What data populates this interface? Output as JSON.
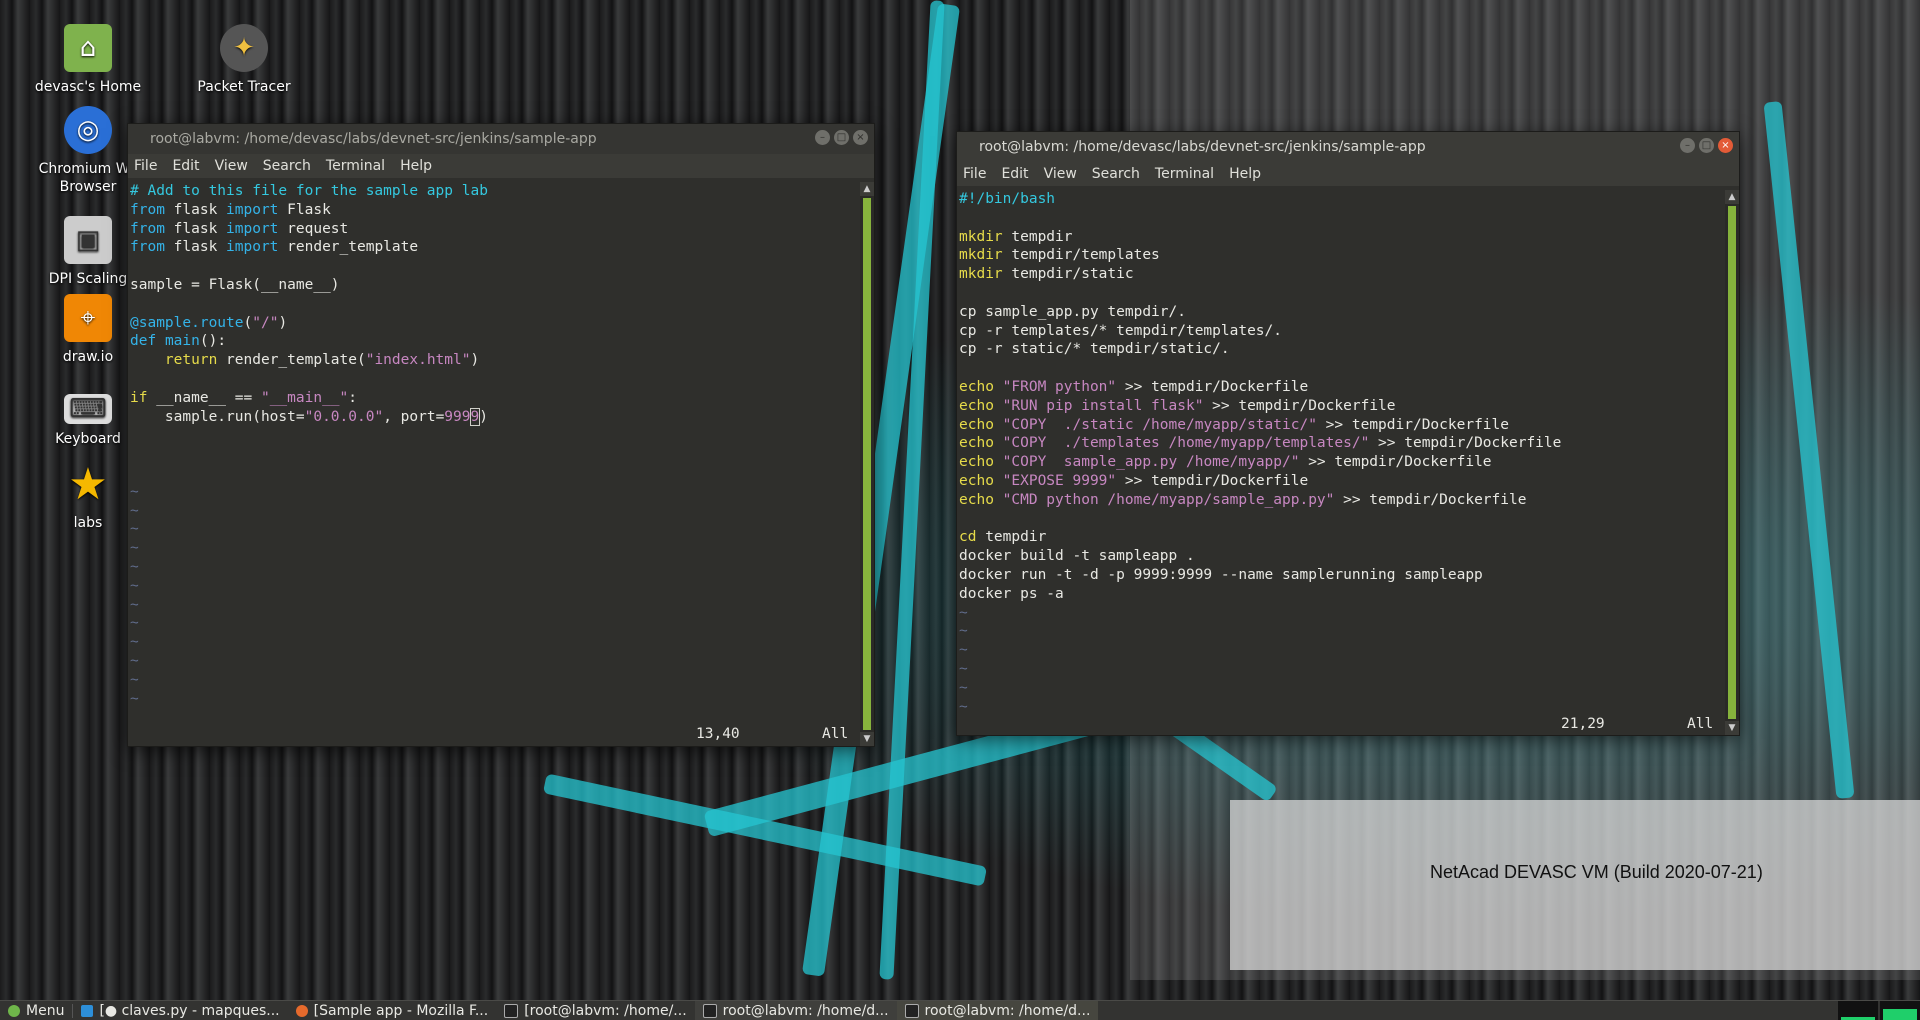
{
  "desktop": {
    "icons": [
      {
        "label": "devasc's Home",
        "icon": "home-folder-icon"
      },
      {
        "label": "Packet Tracer",
        "icon": "packet-tracer-icon"
      },
      {
        "label": "Chromium Web Browser",
        "icon": "chromium-icon"
      },
      {
        "label": "DPI Scaling",
        "icon": "dpi-scaling-icon"
      },
      {
        "label": "draw.io",
        "icon": "drawio-icon"
      },
      {
        "label": "Keyboard",
        "icon": "keyboard-icon"
      },
      {
        "label": "labs",
        "icon": "star-icon"
      }
    ],
    "icon_chromium_line1": "Chromium We",
    "icon_chromium_line2": "Browser",
    "icon_dpi_label": "DPI Scaling",
    "watermark": "NetAcad DEVASC VM (Build 2020-07-21)"
  },
  "left_window": {
    "title": "root@labvm: /home/devasc/labs/devnet-src/jenkins/sample-app",
    "menu": [
      "File",
      "Edit",
      "View",
      "Search",
      "Terminal",
      "Help"
    ],
    "lines": [
      [
        {
          "t": "# Add to this file for the sample app lab",
          "c": "cmt"
        }
      ],
      [
        {
          "t": "from",
          "c": "kw2"
        },
        {
          "t": " flask ",
          "c": ""
        },
        {
          "t": "import",
          "c": "kw2"
        },
        {
          "t": " Flask",
          "c": ""
        }
      ],
      [
        {
          "t": "from",
          "c": "kw2"
        },
        {
          "t": " flask ",
          "c": ""
        },
        {
          "t": "import",
          "c": "kw2"
        },
        {
          "t": " request",
          "c": ""
        }
      ],
      [
        {
          "t": "from",
          "c": "kw2"
        },
        {
          "t": " flask ",
          "c": ""
        },
        {
          "t": "import",
          "c": "kw2"
        },
        {
          "t": " render_template",
          "c": ""
        }
      ],
      [
        {
          "t": "",
          "c": ""
        }
      ],
      [
        {
          "t": "sample = Flask(__name__)",
          "c": ""
        }
      ],
      [
        {
          "t": "",
          "c": ""
        }
      ],
      [
        {
          "t": "@sample.route",
          "c": "kw2"
        },
        {
          "t": "(",
          "c": ""
        },
        {
          "t": "\"/\"",
          "c": "str"
        },
        {
          "t": ")",
          "c": ""
        }
      ],
      [
        {
          "t": "def",
          "c": "kw2"
        },
        {
          "t": " ",
          "c": ""
        },
        {
          "t": "main",
          "c": "kw2"
        },
        {
          "t": "():",
          "c": ""
        }
      ],
      [
        {
          "t": "    ",
          "c": ""
        },
        {
          "t": "return",
          "c": "kw"
        },
        {
          "t": " render_template(",
          "c": ""
        },
        {
          "t": "\"index.html\"",
          "c": "str"
        },
        {
          "t": ")",
          "c": ""
        }
      ],
      [
        {
          "t": "",
          "c": ""
        }
      ],
      [
        {
          "t": "if",
          "c": "kw"
        },
        {
          "t": " __name__ == ",
          "c": ""
        },
        {
          "t": "\"__main__\"",
          "c": "str"
        },
        {
          "t": ":",
          "c": ""
        }
      ],
      [
        {
          "t": "    sample.run(host=",
          "c": ""
        },
        {
          "t": "\"0.0.0.0\"",
          "c": "str"
        },
        {
          "t": ", port=",
          "c": ""
        },
        {
          "t": "999",
          "c": "str"
        },
        {
          "t": "9",
          "c": "str cursor"
        },
        {
          "t": ")",
          "c": ""
        }
      ],
      [
        {
          "t": "",
          "c": ""
        }
      ],
      [
        {
          "t": "",
          "c": ""
        }
      ],
      [
        {
          "t": "",
          "c": ""
        }
      ],
      [
        {
          "t": "~",
          "c": "tilde"
        }
      ],
      [
        {
          "t": "~",
          "c": "tilde"
        }
      ],
      [
        {
          "t": "~",
          "c": "tilde"
        }
      ],
      [
        {
          "t": "~",
          "c": "tilde"
        }
      ],
      [
        {
          "t": "~",
          "c": "tilde"
        }
      ],
      [
        {
          "t": "~",
          "c": "tilde"
        }
      ],
      [
        {
          "t": "~",
          "c": "tilde"
        }
      ],
      [
        {
          "t": "~",
          "c": "tilde"
        }
      ],
      [
        {
          "t": "~",
          "c": "tilde"
        }
      ],
      [
        {
          "t": "~",
          "c": "tilde"
        }
      ],
      [
        {
          "t": "~",
          "c": "tilde"
        }
      ],
      [
        {
          "t": "~",
          "c": "tilde"
        }
      ]
    ],
    "status_pos": "13,40",
    "status_all": "All"
  },
  "right_window": {
    "title": "root@labvm: /home/devasc/labs/devnet-src/jenkins/sample-app",
    "menu": [
      "File",
      "Edit",
      "View",
      "Search",
      "Terminal",
      "Help"
    ],
    "lines": [
      [
        {
          "t": "#!/bin/bash",
          "c": "cmt"
        }
      ],
      [
        {
          "t": "",
          "c": ""
        }
      ],
      [
        {
          "t": "mkdir",
          "c": "kw"
        },
        {
          "t": " tempdir",
          "c": ""
        }
      ],
      [
        {
          "t": "mkdir",
          "c": "kw"
        },
        {
          "t": " tempdir/templates",
          "c": ""
        }
      ],
      [
        {
          "t": "mkdir",
          "c": "kw"
        },
        {
          "t": " tempdir/static",
          "c": ""
        }
      ],
      [
        {
          "t": "",
          "c": ""
        }
      ],
      [
        {
          "t": "cp sample_app.py tempdir/.",
          "c": ""
        }
      ],
      [
        {
          "t": "cp -r templates/* tempdir/templates/.",
          "c": ""
        }
      ],
      [
        {
          "t": "cp -r static/* tempdir/static/.",
          "c": ""
        }
      ],
      [
        {
          "t": "",
          "c": ""
        }
      ],
      [
        {
          "t": "echo",
          "c": "kw"
        },
        {
          "t": " ",
          "c": ""
        },
        {
          "t": "\"FROM python\"",
          "c": "str"
        },
        {
          "t": " >> tempdir/Dockerfile",
          "c": ""
        }
      ],
      [
        {
          "t": "echo",
          "c": "kw"
        },
        {
          "t": " ",
          "c": ""
        },
        {
          "t": "\"RUN pip install flask\"",
          "c": "str"
        },
        {
          "t": " >> tempdir/Dockerfile",
          "c": ""
        }
      ],
      [
        {
          "t": "echo",
          "c": "kw"
        },
        {
          "t": " ",
          "c": ""
        },
        {
          "t": "\"COPY  ./static /home/myapp/static/\"",
          "c": "str"
        },
        {
          "t": " >> tempdir/Dockerfile",
          "c": ""
        }
      ],
      [
        {
          "t": "echo",
          "c": "kw"
        },
        {
          "t": " ",
          "c": ""
        },
        {
          "t": "\"COPY  ./templates /home/myapp/templates/\"",
          "c": "str"
        },
        {
          "t": " >> tempdir/Dockerfile",
          "c": ""
        }
      ],
      [
        {
          "t": "echo",
          "c": "kw"
        },
        {
          "t": " ",
          "c": ""
        },
        {
          "t": "\"COPY  sample_app.py /home/myapp/\"",
          "c": "str"
        },
        {
          "t": " >> tempdir/Dockerfile",
          "c": ""
        }
      ],
      [
        {
          "t": "echo",
          "c": "kw"
        },
        {
          "t": " ",
          "c": ""
        },
        {
          "t": "\"EXPOSE 9999\"",
          "c": "str"
        },
        {
          "t": " >> tempdir/Dockerfile",
          "c": ""
        }
      ],
      [
        {
          "t": "echo",
          "c": "kw"
        },
        {
          "t": " ",
          "c": ""
        },
        {
          "t": "\"CMD python /home/myapp/sample_app.py\"",
          "c": "str"
        },
        {
          "t": " >> tempdir/Dockerfile",
          "c": ""
        }
      ],
      [
        {
          "t": "",
          "c": ""
        }
      ],
      [
        {
          "t": "cd",
          "c": "kw"
        },
        {
          "t": " tempdir",
          "c": ""
        }
      ],
      [
        {
          "t": "docker build -t sampleapp .",
          "c": ""
        }
      ],
      [
        {
          "t": "docker run -t -d -p 9999:9999 --name samplerunning sampleapp",
          "c": ""
        }
      ],
      [
        {
          "t": "docker ps -a",
          "c": ""
        }
      ],
      [
        {
          "t": "~",
          "c": "tilde"
        }
      ],
      [
        {
          "t": "~",
          "c": "tilde"
        }
      ],
      [
        {
          "t": "~",
          "c": "tilde"
        }
      ],
      [
        {
          "t": "~",
          "c": "tilde"
        }
      ],
      [
        {
          "t": "~",
          "c": "tilde"
        }
      ],
      [
        {
          "t": "~",
          "c": "tilde"
        }
      ]
    ],
    "status_pos": "21,29",
    "status_all": "All"
  },
  "taskbar": {
    "menu_label": "Menu",
    "items": [
      {
        "label": "[● claves.py - mapques...",
        "icon": "vscode-icon"
      },
      {
        "label": "[Sample app - Mozilla F...",
        "icon": "firefox-icon"
      },
      {
        "label": "[root@labvm: /home/...",
        "icon": "terminal-icon"
      },
      {
        "label": "root@labvm: /home/d...",
        "icon": "terminal-icon"
      },
      {
        "label": "root@labvm: /home/d...",
        "icon": "terminal-icon"
      }
    ],
    "cpu_level": 0.15,
    "mem_level": 0.6
  },
  "colors": {
    "comment": "#34c8df",
    "keyword_yellow": "#e6db4a",
    "keyword_blue": "#34b3e8",
    "string": "#c787c1",
    "scroll_thumb": "#86b33c",
    "close_button": "#e35b37"
  }
}
